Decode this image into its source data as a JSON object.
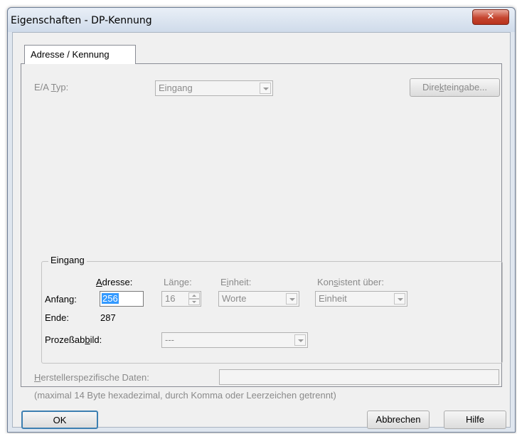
{
  "window": {
    "title": "Eigenschaften - DP-Kennung",
    "close_glyph": "✕"
  },
  "tabs": [
    {
      "label": "Adresse / Kennung",
      "selected": true
    }
  ],
  "io_type": {
    "label_pre": "E/A ",
    "label_u": "T",
    "label_post": "yp:",
    "value": "Eingang"
  },
  "direct_entry_button": {
    "label_pre": "Dire",
    "label_u": "k",
    "label_post": "teingabe..."
  },
  "group": {
    "title": "Eingang",
    "col_address_pre": "",
    "col_address_u": "A",
    "col_address_post": "dresse:",
    "col_length": "Länge:",
    "col_unit_pre": "E",
    "col_unit_u": "i",
    "col_unit_post": "nheit:",
    "col_consistent_pre": "Kon",
    "col_consistent_u": "s",
    "col_consistent_post": "istent über:",
    "start_label": "Anfang:",
    "start_value": "256",
    "end_label": "Ende:",
    "end_value": "287",
    "length_value": "16",
    "unit_value": "Worte",
    "consistent_value": "Einheit",
    "process_image_pre": "Prozeßab",
    "process_image_u": "b",
    "process_image_post": "ild:",
    "process_image_value": "---"
  },
  "vendor_data": {
    "label_pre": "",
    "label_u": "H",
    "label_post": "erstellerspezifische Daten:",
    "value": "",
    "hint": "(maximal 14 Byte hexadezimal, durch Komma oder Leerzeichen getrennt)"
  },
  "buttons": {
    "ok": "OK",
    "cancel": "Abbrechen",
    "help": "Hilfe"
  },
  "colors": {
    "title_bar": "#cfdbea",
    "close_button": "#c5452f",
    "selection": "#3399ff",
    "disabled_text": "#8a8a8a"
  }
}
